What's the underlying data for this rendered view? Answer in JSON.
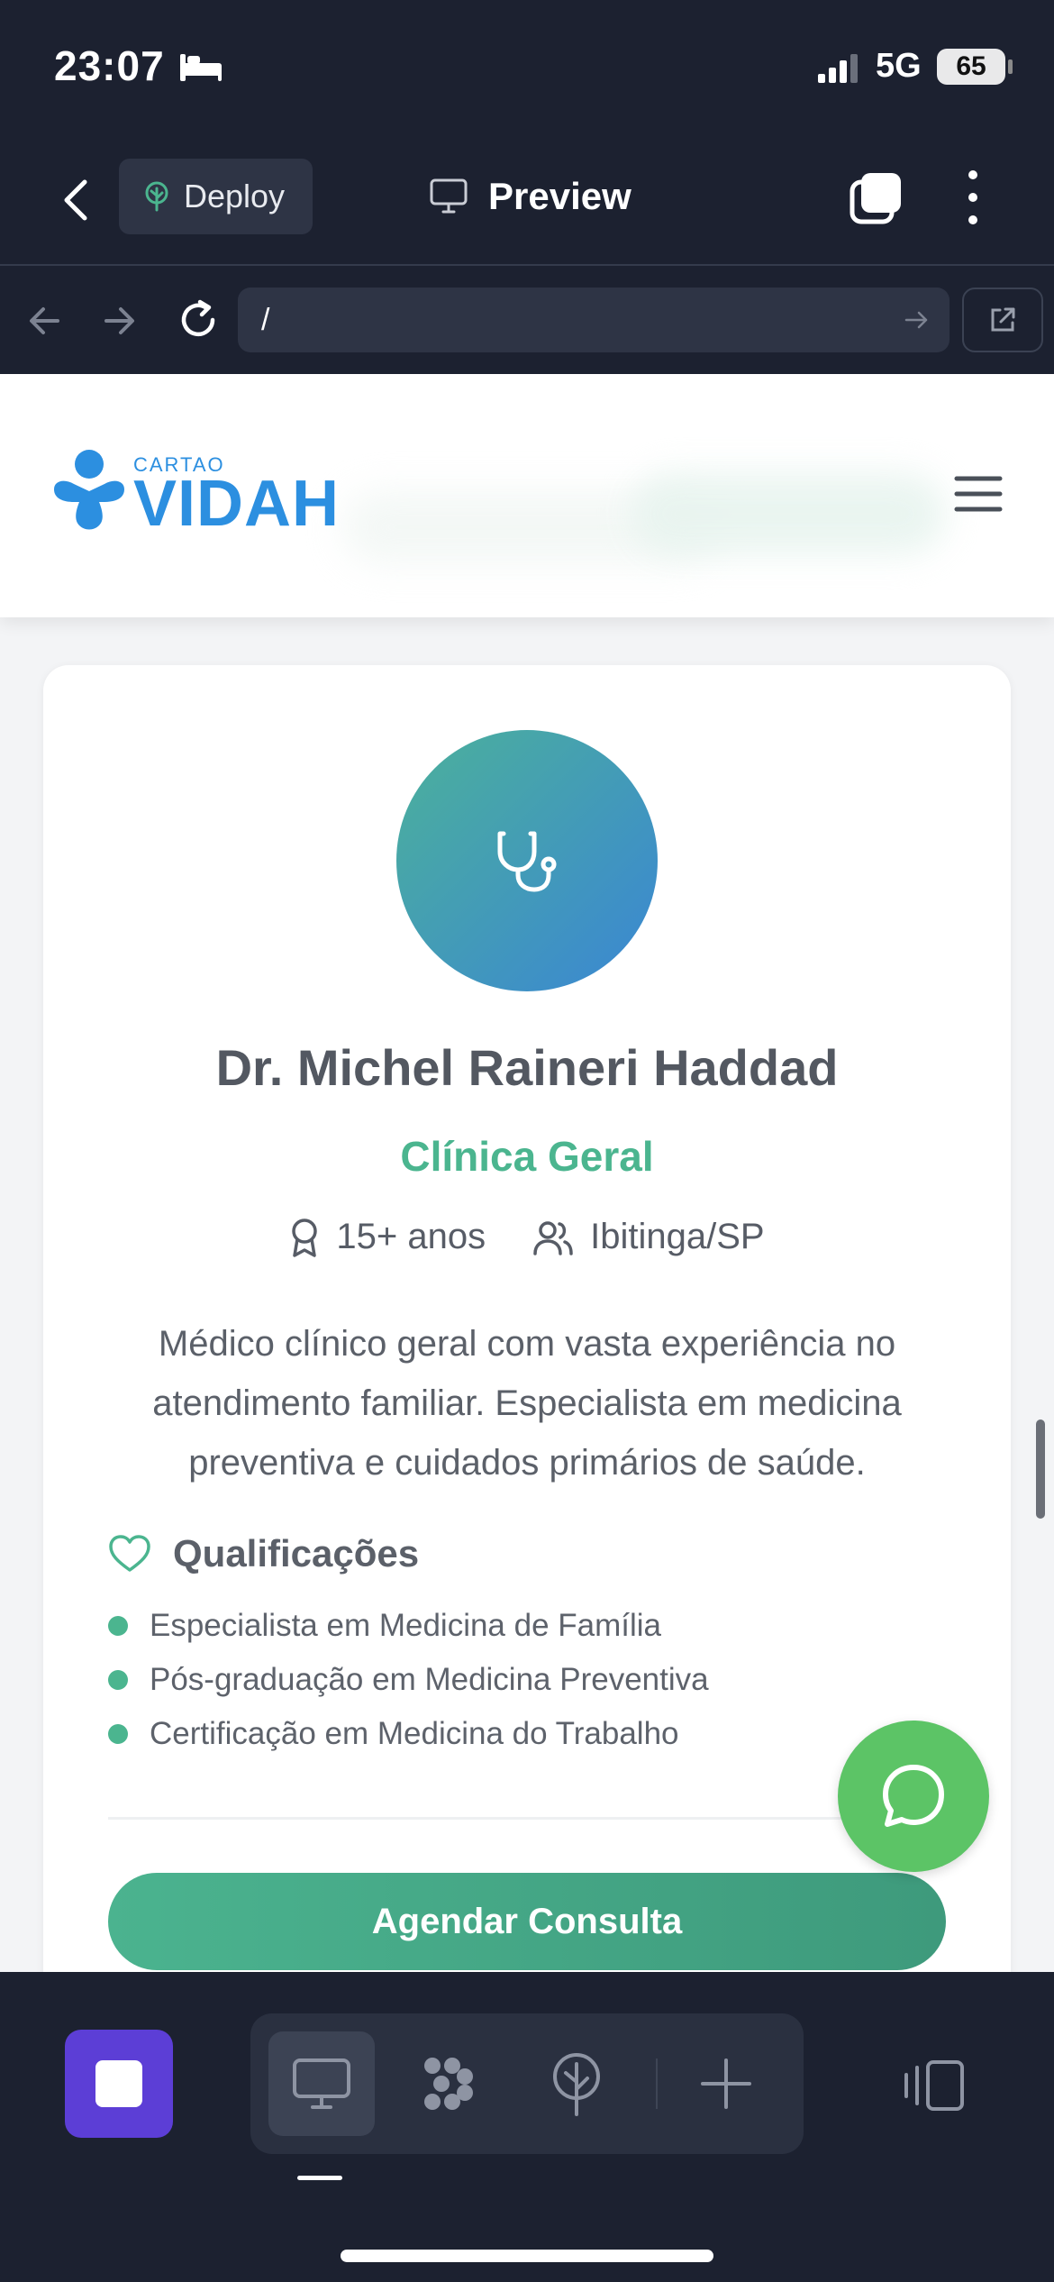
{
  "status_bar": {
    "time": "23:07",
    "network": "5G",
    "battery": "65"
  },
  "app_header": {
    "deploy_label": "Deploy",
    "title": "Preview"
  },
  "url_bar": {
    "url": "/"
  },
  "site": {
    "logo_small": "CARTAO",
    "logo_big": "VIDAH"
  },
  "doctor": {
    "name": "Dr. Michel Raineri Haddad",
    "specialty": "Clínica Geral",
    "experience": "15+ anos",
    "location": "Ibitinga/SP",
    "bio": "Médico clínico geral com vasta experiência no atendimento familiar. Especialista em medicina preventiva e cuidados primários de saúde.",
    "qualifications_title": "Qualificações",
    "qualifications": [
      "Especialista em Medicina de Família",
      "Pós-graduação em Medicina Preventiva",
      "Certificação em Medicina do Trabalho"
    ],
    "cta_label": "Agendar Consulta"
  },
  "colors": {
    "accent": "#4bb58f",
    "brand_blue": "#2c8fe0",
    "stop_button": "#5c3ed6",
    "whatsapp": "#5cc466"
  }
}
